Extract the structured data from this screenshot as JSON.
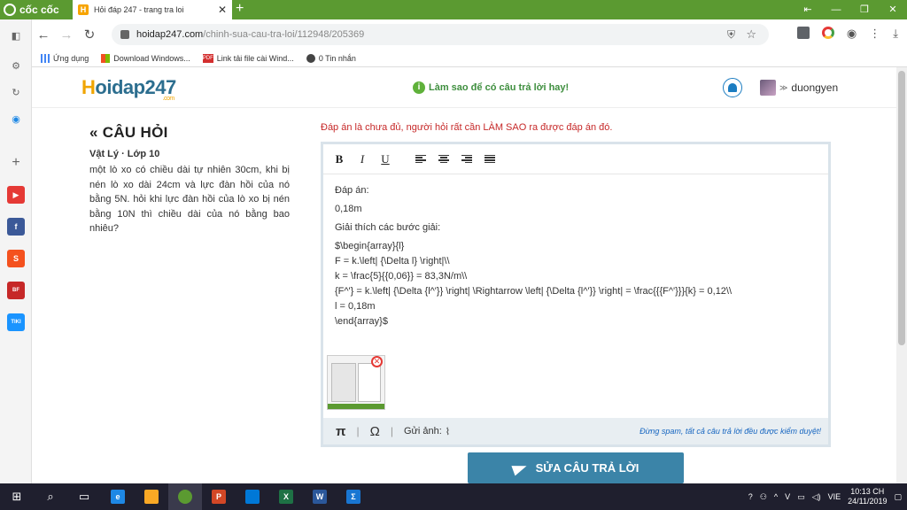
{
  "browser": {
    "brand": "cốc cốc",
    "tab_title": "Hỏi đáp 247 - trang tra loi",
    "tab_favicon": "H",
    "url_host": "hoidap247.com",
    "url_path": "/chinh-sua-cau-tra-loi/112948/205369",
    "bookmarks": [
      {
        "icon": "apps-grid-icon",
        "label": "Ứng dụng"
      },
      {
        "icon": "windows-icon",
        "label": "Download Windows..."
      },
      {
        "icon": "pdf-icon",
        "label": "Link tải file cài Wind..."
      },
      {
        "icon": "globe-icon",
        "label": "0 Tin nhắn"
      }
    ]
  },
  "site": {
    "logo": "oidap247",
    "logo_initial": "H",
    "logo_suffix": ".com",
    "tip": "Làm sao để có câu trả lời hay!",
    "username": "duongyen"
  },
  "question": {
    "heading": "CÂU HỎI",
    "subject": "Vật Lý · Lớp 10",
    "text": "một lò xo có chiều dài tự nhiên 30cm, khi bị nén lò xo dài 24cm và lực đàn hồi của nó bằng 5N. hỏi khi lực đàn hồi của lò xo bị nén bằng 10N   thì chiều dài của nó bằng bao nhiêu?"
  },
  "answer": {
    "warning": "Đáp án là chưa đủ, người hỏi rất cần LÀM SAO ra được đáp án đó.",
    "toolbar": [
      "B",
      "I",
      "U"
    ],
    "lines": [
      "Đáp án:",
      " 0,18m",
      "Giải thích các bước giải:",
      "$\\begin{array}{l}",
      "F = k.\\left| {\\Delta l} \\right|\\\\",
      "k = \\frac{5}{{0,06}} = 83,3N/m\\\\",
      "{F^'} = k.\\left| {\\Delta {l^'}} \\right| \\Rightarrow \\left| {\\Delta {l^'}} \\right| = \\frac{{{F^'}}}{k} = 0,12\\\\",
      "l = 0,18m",
      "\\end{array}$"
    ],
    "footer_pi": "π",
    "footer_omega": "Ω",
    "footer_upload": "Gửi ảnh:",
    "footer_spam": "Đừng spam, tất cả câu trả lời đều được kiểm duyệt!",
    "submit_label": "SỬA CÂU TRẢ LỜI"
  },
  "taskbar": {
    "time": "10:13 CH",
    "date": "24/11/2019",
    "lang": "VIE"
  },
  "colors": {
    "brand_green": "#5b9a31",
    "warning_red": "#c62828",
    "submit_blue": "#3b84a8"
  }
}
